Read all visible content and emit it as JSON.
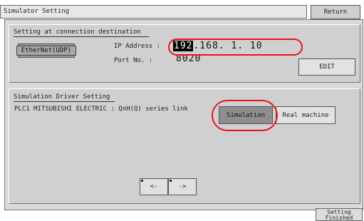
{
  "window": {
    "title": "Simulator Setting"
  },
  "header": {
    "return_label": "Return"
  },
  "connection": {
    "legend": "Setting at connection destination",
    "method_button": "EtherNet(UDP)",
    "ip_label": "IP Address :",
    "ip_first_octet": "192",
    "ip_rest": ".168.   1.  10",
    "port_label": "Port No.  :",
    "port_value": "8020",
    "edit_label": "EDIT"
  },
  "simulation": {
    "legend": "Simulation Driver Setting",
    "driver_text": "PLC1  MITSUBISHI ELECTRIC : QnH(Q) series link",
    "simulation_label": "Simulation",
    "real_machine_label": "Real machine"
  },
  "navigation": {
    "prev_label": "<-",
    "next_label": "->"
  },
  "footer": {
    "setting_finished_label": "Setting Finished"
  },
  "colors": {
    "highlight_oval": "#e8141b",
    "panel": "#d0d0d0",
    "selected_button": "#8e8e8e"
  },
  "selected": {
    "connection_method": "EtherNet(UDP)",
    "driver_mode": "Simulation"
  }
}
